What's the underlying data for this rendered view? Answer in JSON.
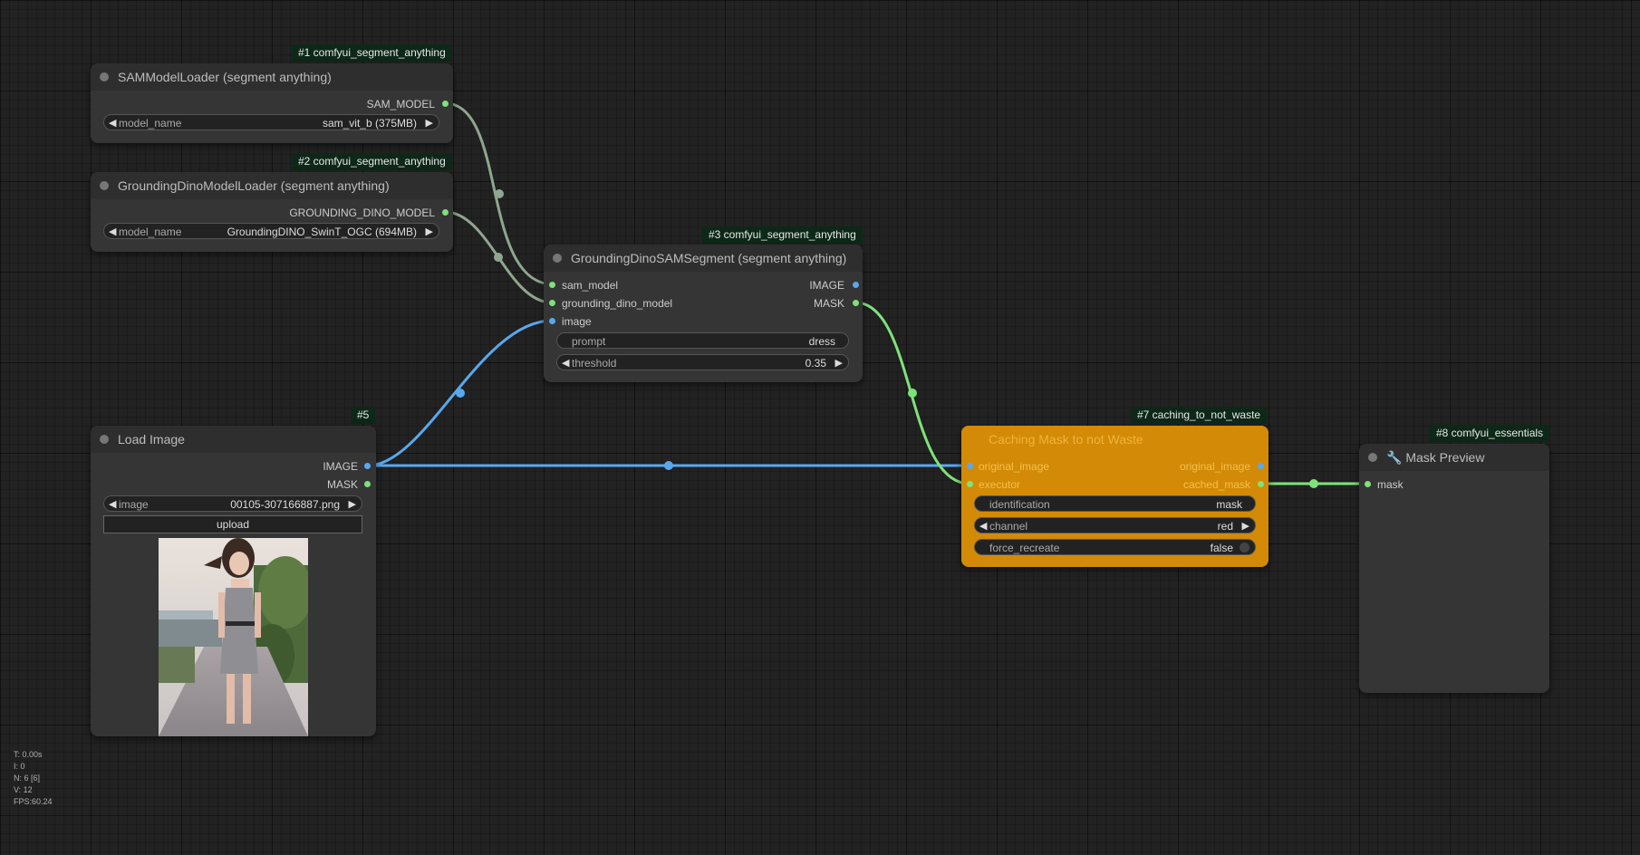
{
  "stats": {
    "t": "T: 0.00s",
    "i": "I: 0",
    "n": "N: 6 [6]",
    "v": "V: 12",
    "fps": "FPS:60.24"
  },
  "colors": {
    "image_link": "#59a8ee",
    "mask_link": "#7ee27a",
    "model_link": "#8fa68f",
    "accent_node": "#d38a06"
  },
  "nodes": {
    "sam_loader": {
      "badge": "#1 comfyui_segment_anything",
      "title": "SAMModelLoader (segment anything)",
      "output": "SAM_MODEL",
      "widget": {
        "label": "model_name",
        "value": "sam_vit_b (375MB)"
      }
    },
    "dino_loader": {
      "badge": "#2 comfyui_segment_anything",
      "title": "GroundingDinoModelLoader (segment anything)",
      "output": "GROUNDING_DINO_MODEL",
      "widget": {
        "label": "model_name",
        "value": "GroundingDINO_SwinT_OGC (694MB)"
      }
    },
    "segment": {
      "badge": "#3 comfyui_segment_anything",
      "title": "GroundingDinoSAMSegment (segment anything)",
      "inputs": [
        "sam_model",
        "grounding_dino_model",
        "image"
      ],
      "outputs": [
        "IMAGE",
        "MASK"
      ],
      "prompt": {
        "label": "prompt",
        "value": "dress"
      },
      "threshold": {
        "label": "threshold",
        "value": "0.35"
      }
    },
    "load_image": {
      "badge": "#5",
      "title": "Load Image",
      "outputs": [
        "IMAGE",
        "MASK"
      ],
      "widget": {
        "label": "image",
        "value": "00105-307166887.png"
      },
      "upload_label": "upload"
    },
    "caching": {
      "badge": "#7 caching_to_not_waste",
      "title": "Caching Mask to not Waste",
      "inputs": [
        "original_image",
        "executor"
      ],
      "outputs": [
        "original_image",
        "cached_mask"
      ],
      "identification": {
        "label": "identification",
        "value": "mask"
      },
      "channel": {
        "label": "channel",
        "value": "red"
      },
      "force_recreate": {
        "label": "force_recreate",
        "value": "false"
      }
    },
    "mask_preview": {
      "badge": "#8 comfyui_essentials",
      "title": "🔧 Mask Preview",
      "inputs": [
        "mask"
      ]
    }
  }
}
